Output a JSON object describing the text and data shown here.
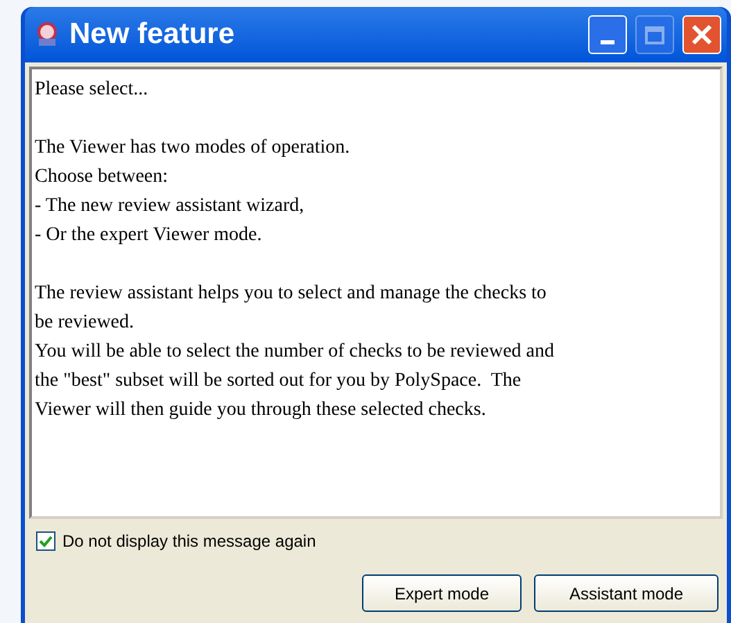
{
  "window": {
    "title": "New feature"
  },
  "message": {
    "paragraphs": [
      [
        "Please select..."
      ],
      [
        "The Viewer has two modes of operation.",
        "Choose between:",
        "- The new review assistant wizard,",
        "- Or the expert Viewer mode."
      ],
      [
        "The review assistant helps you to select and manage the checks to",
        "be reviewed.",
        "You will be able to select the number of checks to be reviewed and",
        "the \"best\" subset will be sorted out for you by PolySpace.  The",
        "Viewer will then guide you through these selected checks."
      ]
    ]
  },
  "dont_show_again": {
    "label": "Do not display this message again",
    "checked": true
  },
  "buttons": [
    "Expert mode",
    "Assistant mode"
  ]
}
